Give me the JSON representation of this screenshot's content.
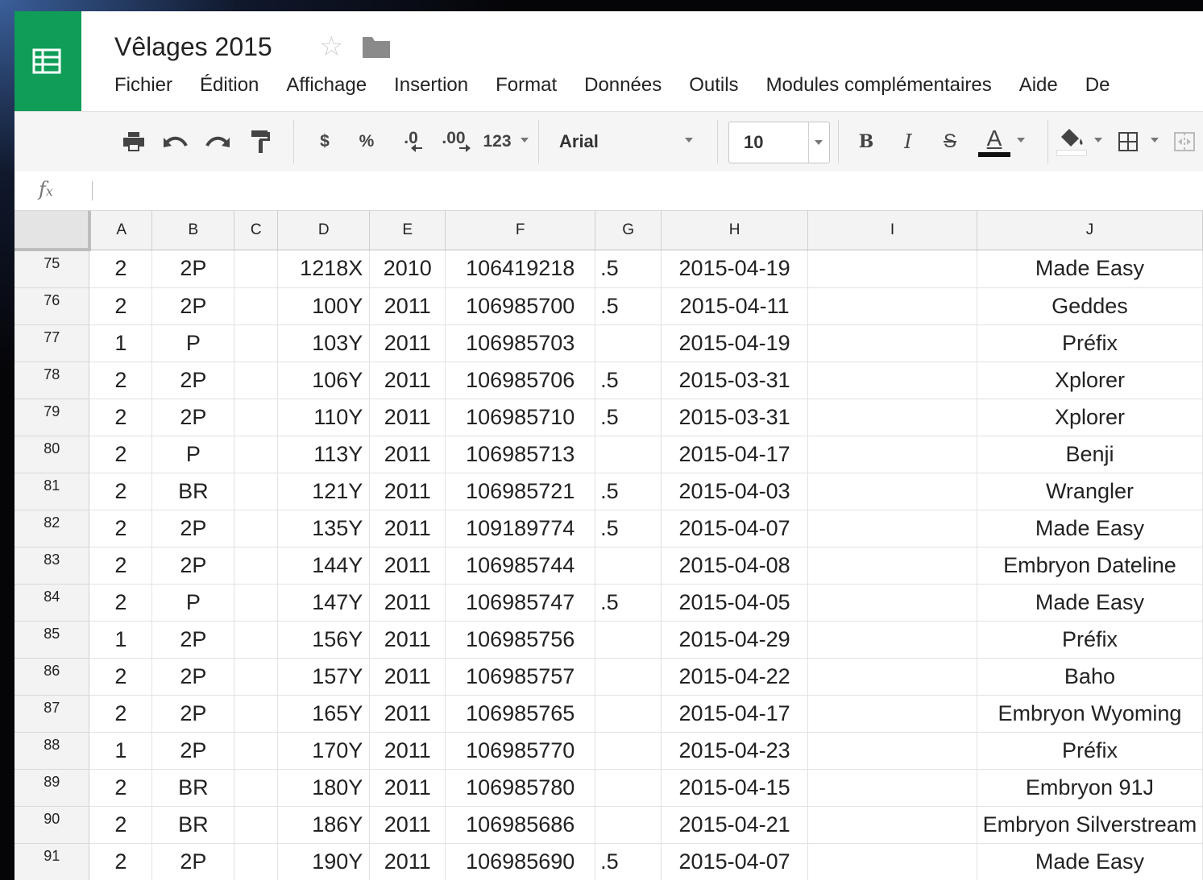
{
  "document": {
    "title": "Vêlages 2015"
  },
  "menu": [
    {
      "label": "Fichier"
    },
    {
      "label": "Édition"
    },
    {
      "label": "Affichage"
    },
    {
      "label": "Insertion"
    },
    {
      "label": "Format"
    },
    {
      "label": "Données"
    },
    {
      "label": "Outils"
    },
    {
      "label": "Modules complémentaires"
    },
    {
      "label": "Aide"
    },
    {
      "label": "De"
    }
  ],
  "toolbar": {
    "currency": "$",
    "percent": "%",
    "decrease_decimals": ".0",
    "increase_decimals": ".00",
    "more_formats": "123",
    "font": "Arial",
    "font_size": "10",
    "bold": "B",
    "italic": "I",
    "strikethrough": "S",
    "text_color": "A"
  },
  "formula_bar": {
    "fx": "fx",
    "value": ""
  },
  "columns": [
    "A",
    "B",
    "C",
    "D",
    "E",
    "F",
    "G",
    "H",
    "I",
    "J"
  ],
  "rows": [
    {
      "n": "75",
      "A": "2",
      "B": "2P",
      "C": "",
      "D": "1218X",
      "E": "2010",
      "F": "106419218",
      "G": ".5",
      "H": "2015-04-19",
      "I": "",
      "J": "Made Easy"
    },
    {
      "n": "76",
      "A": "2",
      "B": "2P",
      "C": "",
      "D": "100Y",
      "E": "2011",
      "F": "106985700",
      "G": ".5",
      "H": "2015-04-11",
      "I": "",
      "J": "Geddes"
    },
    {
      "n": "77",
      "A": "1",
      "B": "P",
      "C": "",
      "D": "103Y",
      "E": "2011",
      "F": "106985703",
      "G": "",
      "H": "2015-04-19",
      "I": "",
      "J": "Préfix"
    },
    {
      "n": "78",
      "A": "2",
      "B": "2P",
      "C": "",
      "D": "106Y",
      "E": "2011",
      "F": "106985706",
      "G": ".5",
      "H": "2015-03-31",
      "I": "",
      "J": "Xplorer"
    },
    {
      "n": "79",
      "A": "2",
      "B": "2P",
      "C": "",
      "D": "110Y",
      "E": "2011",
      "F": "106985710",
      "G": ".5",
      "H": "2015-03-31",
      "I": "",
      "J": "Xplorer"
    },
    {
      "n": "80",
      "A": "2",
      "B": "P",
      "C": "",
      "D": "113Y",
      "E": "2011",
      "F": "106985713",
      "G": "",
      "H": "2015-04-17",
      "I": "",
      "J": "Benji"
    },
    {
      "n": "81",
      "A": "2",
      "B": "BR",
      "C": "",
      "D": "121Y",
      "E": "2011",
      "F": "106985721",
      "G": ".5",
      "H": "2015-04-03",
      "I": "",
      "J": "Wrangler"
    },
    {
      "n": "82",
      "A": "2",
      "B": "2P",
      "C": "",
      "D": "135Y",
      "E": "2011",
      "F": "109189774",
      "G": ".5",
      "H": "2015-04-07",
      "I": "",
      "J": "Made Easy"
    },
    {
      "n": "83",
      "A": "2",
      "B": "2P",
      "C": "",
      "D": "144Y",
      "E": "2011",
      "F": "106985744",
      "G": "",
      "H": "2015-04-08",
      "I": "",
      "J": "Embryon Dateline"
    },
    {
      "n": "84",
      "A": "2",
      "B": "P",
      "C": "",
      "D": "147Y",
      "E": "2011",
      "F": "106985747",
      "G": ".5",
      "H": "2015-04-05",
      "I": "",
      "J": "Made Easy"
    },
    {
      "n": "85",
      "A": "1",
      "B": "2P",
      "C": "",
      "D": "156Y",
      "E": "2011",
      "F": "106985756",
      "G": "",
      "H": "2015-04-29",
      "I": "",
      "J": "Préfix"
    },
    {
      "n": "86",
      "A": "2",
      "B": "2P",
      "C": "",
      "D": "157Y",
      "E": "2011",
      "F": "106985757",
      "G": "",
      "H": "2015-04-22",
      "I": "",
      "J": "Baho"
    },
    {
      "n": "87",
      "A": "2",
      "B": "2P",
      "C": "",
      "D": "165Y",
      "E": "2011",
      "F": "106985765",
      "G": "",
      "H": "2015-04-17",
      "I": "",
      "J": "Embryon Wyoming"
    },
    {
      "n": "88",
      "A": "1",
      "B": "2P",
      "C": "",
      "D": "170Y",
      "E": "2011",
      "F": "106985770",
      "G": "",
      "H": "2015-04-23",
      "I": "",
      "J": "Préfix"
    },
    {
      "n": "89",
      "A": "2",
      "B": "BR",
      "C": "",
      "D": "180Y",
      "E": "2011",
      "F": "106985780",
      "G": "",
      "H": "2015-04-15",
      "I": "",
      "J": "Embryon 91J"
    },
    {
      "n": "90",
      "A": "2",
      "B": "BR",
      "C": "",
      "D": "186Y",
      "E": "2011",
      "F": "106985686",
      "G": "",
      "H": "2015-04-21",
      "I": "",
      "J": "Embryon Silverstream"
    },
    {
      "n": "91",
      "A": "2",
      "B": "2P",
      "C": "",
      "D": "190Y",
      "E": "2011",
      "F": "106985690",
      "G": ".5",
      "H": "2015-04-07",
      "I": "",
      "J": "Made Easy"
    }
  ],
  "colors": {
    "brand_green": "#0f9d58",
    "toolbar_bg": "#f5f5f5",
    "header_cell_bg": "#f3f3f3"
  }
}
